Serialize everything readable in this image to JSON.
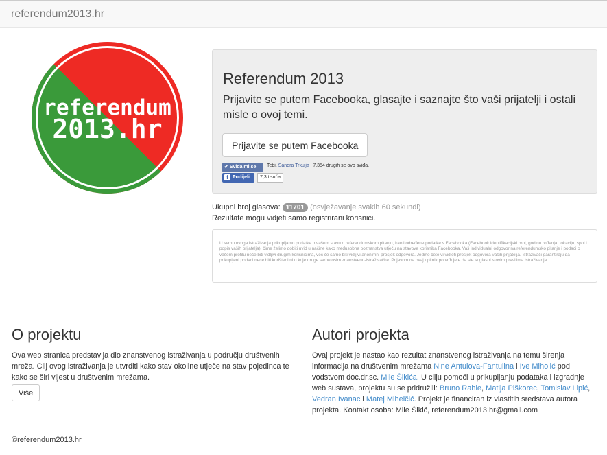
{
  "navbar": {
    "brand": "referendum2013.hr"
  },
  "logo": {
    "line1": "referendum",
    "line2": "2013.hr",
    "colors": {
      "green": "#3a9a3a",
      "red": "#ee2a24",
      "ring": "#ffffff"
    }
  },
  "jumbotron": {
    "title": "Referendum 2013",
    "lead": "Prijavite se putem Facebooka, glasajte i saznajte što vaši prijatelji i ostali misle o ovoj temi.",
    "login_button": "Prijavite se putem Facebooka",
    "like_button": "Sviđa mi se",
    "like_text_prefix": "Tebi, ",
    "like_friend": "Sandra Trkulja",
    "like_text_suffix": " i 7.354 drugih se ovo sviđa.",
    "share_button": "Podijeli",
    "share_count": "7,3 tisuća"
  },
  "votes": {
    "label": "Ukupni broj glasova:",
    "count": "11701",
    "refresh": "(osvježavanje svakih 60 sekundi)",
    "note": "Rezultate mogu vidjeti samo registrirani korisnici."
  },
  "disclaimer": "U svrhu ovoga istraživanja prikupljamo podatke o vašem stavu o referendumskom pitanju, kao i određene podatke s Facebooka (Facebook identifikacijski broj, godinu rođenja, lokaciju, spol i popis vaših prijatelja), čime želimo dobiti uvid u načine kako međusobna poznanstva utječu na stavove korisnika Facebooka. Vaš individualni odgovor na referendumsko pitanje i podaci o vašem profilu neće biti vidljivi drugim korisnicima, već će samo biti vidljivi anonimni prosjek odgovora. Jedino ćete vi vidjeti prosjek odgovora vaših prijatelja. Istraživači garantiraju da prikupljeni podaci neće biti korišteni ni u koje druge svrhe osim znanstveno-istraživačke. Prijavom na ovaj upitnik potvrđujete da ste suglasni s ovim pravilima istraživanja.",
  "about": {
    "title": "O projektu",
    "text": "Ova web stranica predstavlja dio znanstvenog istraživanja u području društvenih mreža. Cilj ovog istraživanja je utvrditi kako stav okoline utječe na stav pojedinca te kako se širi vijest u društvenim mrežama.",
    "more_button": "Više"
  },
  "authors": {
    "title": "Autori projekta",
    "t1": "Ovaj projekt je nastao kao rezultat znanstvenog istraživanja na temu širenja informacija na društvenim mrežama ",
    "a1": "Nine Antulova-Fantulina",
    "t2": " i ",
    "a2": "Ive Miholić",
    "t3": " pod vodstvom doc.dr.sc. ",
    "a3": "Mile Šikića",
    "t4": ". U cilju pomoći u prikupljanju podataka i izgradnje web sustava, projektu su se pridružili: ",
    "a4": "Bruno Rahle",
    "t5": ", ",
    "a5": "Matija Piškorec",
    "t6": ", ",
    "a6": "Tomislav Lipić",
    "t7": ", ",
    "a7": "Vedran Ivanac",
    "t8": " i ",
    "a8": "Matej Mihelčić",
    "t9": ". Projekt je financiran iz vlastitih sredstava autora projekta. Kontakt osoba: Mile Šikić, referendum2013.hr@gmail.com"
  },
  "footer": {
    "copyright": "©referendum2013.hr"
  }
}
